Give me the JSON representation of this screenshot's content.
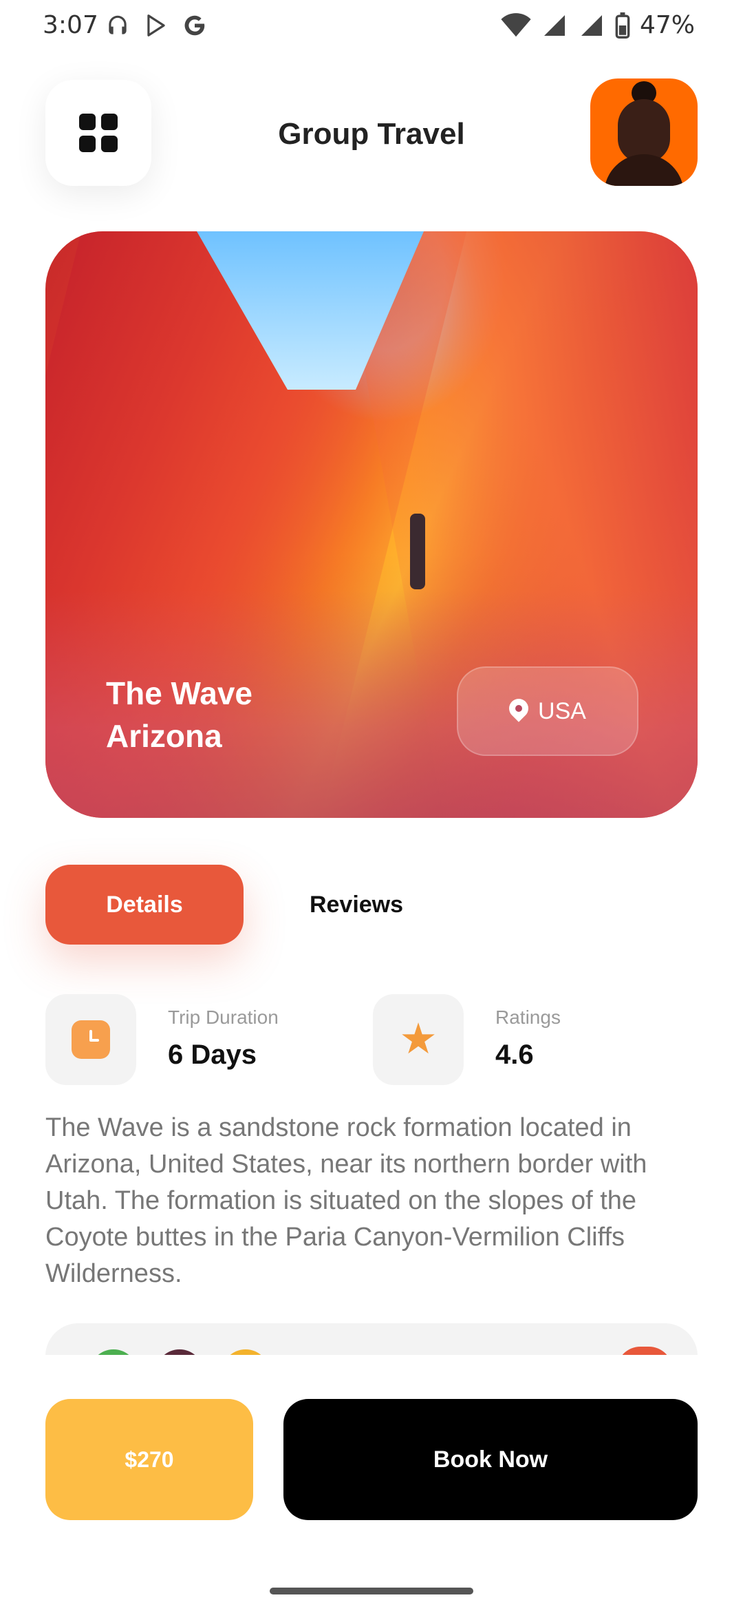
{
  "status_bar": {
    "time": "3:07",
    "battery": "47%"
  },
  "header": {
    "title": "Group Travel",
    "menu_icon": "grid-icon",
    "avatar": "profile avatar"
  },
  "hero": {
    "title_line1": "The Wave",
    "title_line2": "Arizona",
    "location": "USA"
  },
  "tabs": [
    {
      "label": "Details",
      "active": true
    },
    {
      "label": "Reviews",
      "active": false
    }
  ],
  "info": {
    "duration_label": "Trip Duration",
    "duration_value": "6 Days",
    "ratings_label": "Ratings",
    "ratings_value": "4.6"
  },
  "description": "The Wave is a sandstone rock formation located in Arizona, United States, near its northern border with Utah. The formation is situated on the slopes of the Coyote buttes in the Paria Canyon-Vermilion Cliffs Wilderness.",
  "footer": {
    "price": "$270",
    "book_label": "Book Now"
  },
  "colors": {
    "accent": "#e8583b",
    "price": "#fdbd45",
    "book": "#000000"
  }
}
